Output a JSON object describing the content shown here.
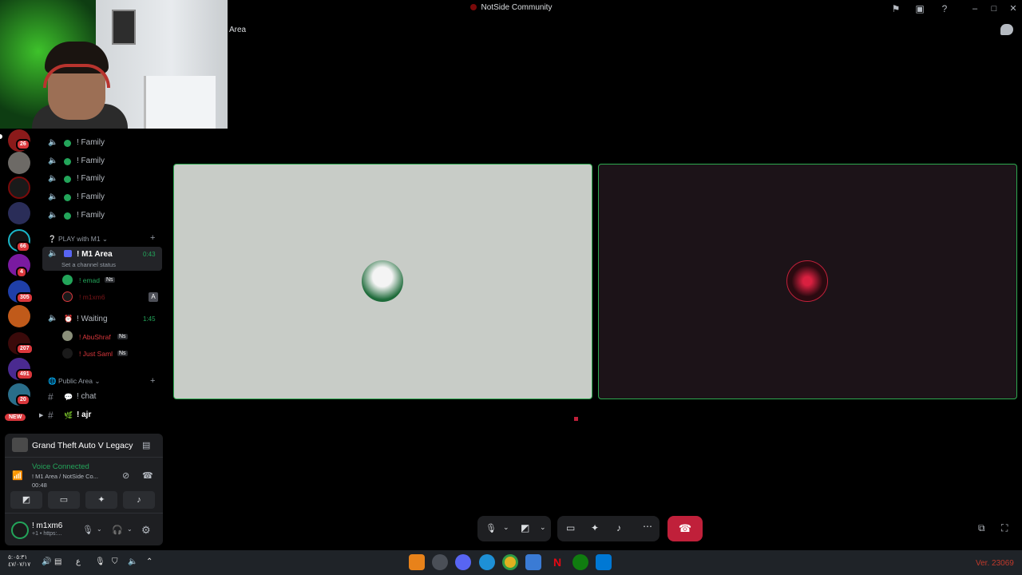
{
  "window": {
    "title": "NotSide Community"
  },
  "channel_header": {
    "partial_title": "Area"
  },
  "sidebar": {
    "family_channels": [
      {
        "name": "! Family"
      },
      {
        "name": "! Family"
      },
      {
        "name": "! Family"
      },
      {
        "name": "! Family"
      },
      {
        "name": "! Family"
      }
    ],
    "category_play": "PLAY with M1",
    "m1_area": {
      "name": "! M1 Area",
      "timer": "0:43",
      "status": "Set a channel status"
    },
    "m1_members": [
      {
        "name": "! emad",
        "tag": "Ns",
        "color": "#23a55a"
      },
      {
        "name": "! m1xm6",
        "color": "#da373c"
      }
    ],
    "waiting": {
      "name": "! Waiting",
      "timer": "1:45"
    },
    "waiting_members": [
      {
        "name": "! AbuShraf",
        "tag": "Ns",
        "color": "#da373c"
      },
      {
        "name": "! Just Saml",
        "tag": "Ns",
        "color": "#da373c"
      }
    ],
    "category_public": "Public Area",
    "text_channels": [
      {
        "name": "! chat"
      },
      {
        "name": "! ajr"
      }
    ]
  },
  "server_badges": [
    "26",
    "66",
    "4",
    "305",
    "207",
    "491",
    "20",
    "NEW"
  ],
  "activity": {
    "game": "Grand Theft Auto V Legacy"
  },
  "voice": {
    "status": "Voice Connected",
    "location": "! M1 Area / NotSide Co...",
    "elapsed": "00:48"
  },
  "user": {
    "name": "! m1xm6",
    "sub": "+1 • https:..."
  },
  "taskbar": {
    "date_line1": "٥:٠٥:٣١",
    "date_line2": "٤٧/٠٧/١٧",
    "lang": "ع",
    "version": "Ver. 23069"
  },
  "colors": {
    "accent_green": "#23a55a",
    "hangup_red": "#c0203a",
    "tile_border": "#2da94f"
  }
}
